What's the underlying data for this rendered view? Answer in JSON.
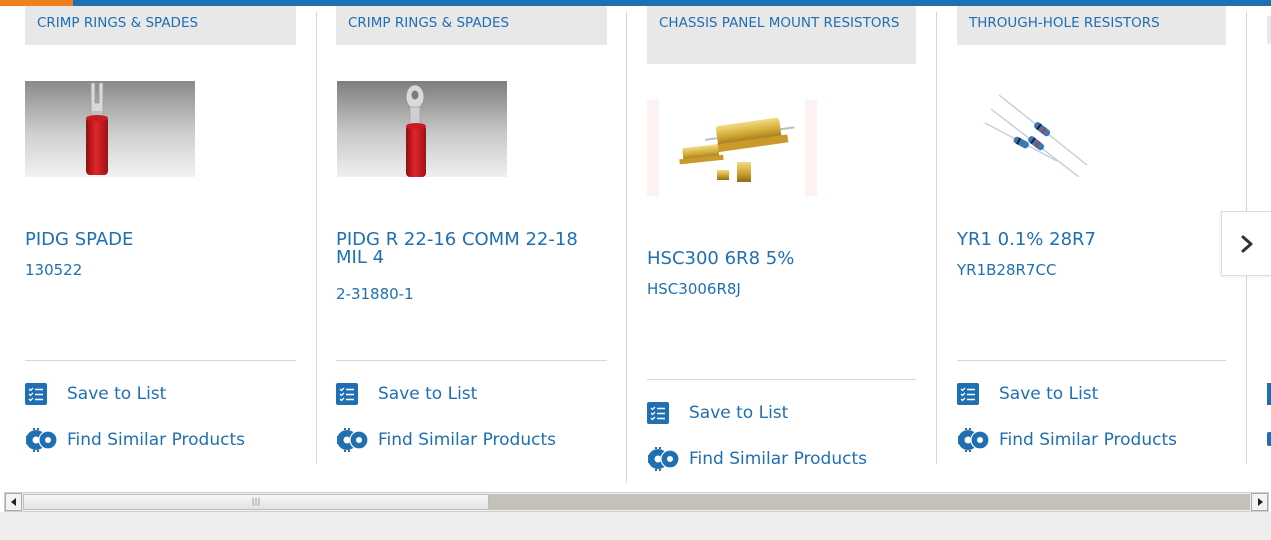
{
  "products": [
    {
      "category": "CRIMP RINGS & SPADES",
      "title": "PIDG SPADE",
      "part_number": "130522",
      "image": "spade-terminal-image"
    },
    {
      "category": "CRIMP RINGS & SPADES",
      "title": "PIDG R 22-16 COMM 22-18 MIL 4",
      "part_number": "2-31880-1",
      "image": "ring-terminal-image"
    },
    {
      "category": "CHASSIS PANEL MOUNT RESISTORS",
      "title": "HSC300 6R8 5%",
      "part_number": "HSC3006R8J",
      "image": "chassis-resistor-image"
    },
    {
      "category": "THROUGH-HOLE RESISTORS",
      "title": "YR1 0.1% 28R7",
      "part_number": "YR1B28R7CC",
      "image": "through-hole-resistor-image"
    }
  ],
  "actions": {
    "save_label": "Save to List",
    "similar_label": "Find Similar Products"
  },
  "carousel": {
    "next_icon": "chevron-right-icon"
  },
  "colors": {
    "link": "#1f6fb3",
    "accent": "#f07f1d",
    "category_bg": "#e8e8e8"
  }
}
